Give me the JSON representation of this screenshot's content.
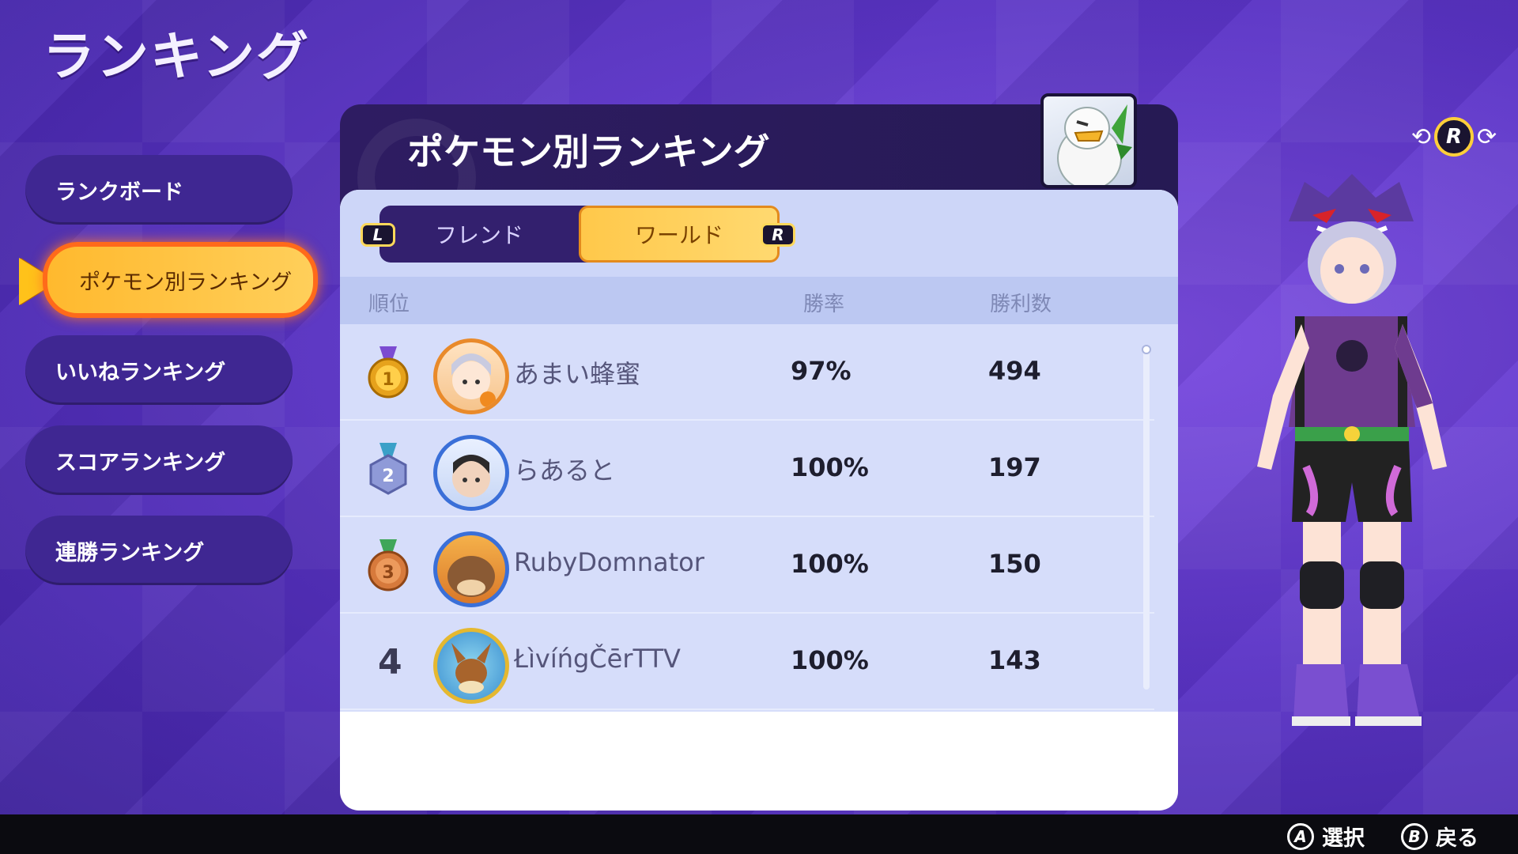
{
  "page_title": "ランキング",
  "sidebar": {
    "items": [
      {
        "label": "ランクボード",
        "active": false
      },
      {
        "label": "ポケモン別ランキング",
        "active": true
      },
      {
        "label": "いいねランキング",
        "active": false
      },
      {
        "label": "スコアランキング",
        "active": false
      },
      {
        "label": "連勝ランキング",
        "active": false
      }
    ]
  },
  "panel": {
    "title": "ポケモン別ランキング",
    "tabs": {
      "friend_label": "フレンド",
      "world_label": "ワールド",
      "selected": "ワールド",
      "left_button": "L",
      "right_button": "R"
    },
    "columns": {
      "rank": "順位",
      "winrate": "勝率",
      "wins": "勝利数"
    },
    "rows": [
      {
        "rank": "1",
        "name": "あまい蜂蜜",
        "winrate": "97%",
        "wins": "494",
        "medal": "gold"
      },
      {
        "rank": "2",
        "name": "らあると",
        "winrate": "100%",
        "wins": "197",
        "medal": "silver"
      },
      {
        "rank": "3",
        "name": "RubyDomnator",
        "winrate": "100%",
        "wins": "150",
        "medal": "bronze"
      },
      {
        "rank": "4",
        "name": "ŁìvíńgČērTTV",
        "winrate": "100%",
        "wins": "143",
        "medal": "none"
      }
    ]
  },
  "rotate_hint": {
    "button": "R"
  },
  "footer": {
    "select_button": "A",
    "select_label": "選択",
    "back_button": "B",
    "back_label": "戻る"
  },
  "colors": {
    "background": "#5a34c4",
    "active_item": "#ffc84a",
    "active_border": "#ff6a1a",
    "panel_header": "#2e1c62",
    "row_background": "#d6ddfa"
  }
}
